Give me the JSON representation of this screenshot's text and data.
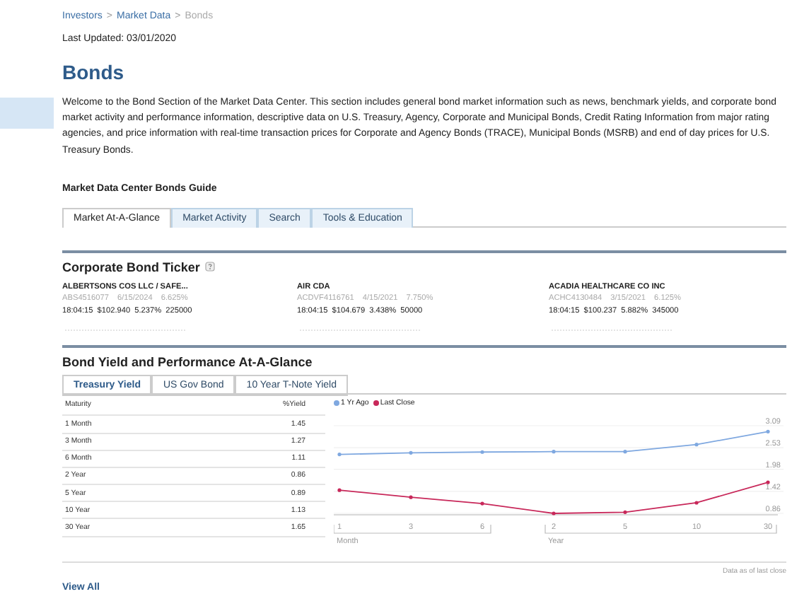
{
  "breadcrumb_separator": ">",
  "breadcrumb": [
    {
      "label": "Investors",
      "current": false
    },
    {
      "label": "Market Data",
      "current": false
    },
    {
      "label": "Bonds",
      "current": true
    }
  ],
  "last_updated": "Last Updated: 03/01/2020",
  "title": "Bonds",
  "intro": "Welcome to the Bond Section of the Market Data Center. This section includes general bond market information such as news, benchmark yields, and corporate bond market activity and performance information, descriptive data on U.S. Treasury, Agency, Corporate and Municipal Bonds, Credit Rating Information from major rating agencies, and price information with real-time transaction prices for Corporate and Agency Bonds (TRACE), Municipal Bonds (MSRB) and end of day prices for U.S. Treasury Bonds.",
  "guide_title": "Market Data Center Bonds Guide",
  "guide_tabs": [
    {
      "label": "Market At-A-Glance",
      "selected": true
    },
    {
      "label": "Market Activity",
      "selected": false
    },
    {
      "label": "Search",
      "selected": false
    },
    {
      "label": "Tools & Education",
      "selected": false
    }
  ],
  "ticker": {
    "title": "Corporate Bond Ticker",
    "items": [
      {
        "name": "ALBERTSONS COS LLC / SAFE...",
        "symbol": "ABS4516077",
        "maturity": "6/15/2024",
        "coupon": "6.625%",
        "time": "18:04:15",
        "price": "$102.940",
        "yield": "5.237%",
        "volume": "225000"
      },
      {
        "name": "AIR CDA",
        "symbol": "ACDVF4116761",
        "maturity": "4/15/2021",
        "coupon": "7.750%",
        "time": "18:04:15",
        "price": "$104.679",
        "yield": "3.438%",
        "volume": "50000"
      },
      {
        "name": "ACADIA HEALTHCARE CO INC",
        "symbol": "ACHC4130484",
        "maturity": "3/15/2021",
        "coupon": "6.125%",
        "time": "18:04:15",
        "price": "$100.237",
        "yield": "5.882%",
        "volume": "345000"
      }
    ]
  },
  "yield_section": {
    "title": "Bond Yield and Performance At-A-Glance",
    "tabs": [
      {
        "label": "Treasury Yield",
        "selected": true
      },
      {
        "label": "US Gov Bond",
        "selected": false
      },
      {
        "label": "10 Year T-Note Yield",
        "selected": false
      }
    ],
    "table": {
      "columns": [
        "Maturity",
        "%Yield"
      ],
      "rows": [
        [
          "1 Month",
          "1.45"
        ],
        [
          "3 Month",
          "1.27"
        ],
        [
          "6 Month",
          "1.11"
        ],
        [
          "2 Year",
          "0.86"
        ],
        [
          "5 Year",
          "0.89"
        ],
        [
          "10 Year",
          "1.13"
        ],
        [
          "30 Year",
          "1.65"
        ]
      ]
    },
    "chart_data": {
      "type": "line",
      "categories": [
        "1",
        "3",
        "6",
        "2",
        "5",
        "10",
        "30"
      ],
      "series": [
        {
          "name": "1 Yr Ago",
          "color": "#7fa8e0",
          "values": [
            2.36,
            2.4,
            2.42,
            2.43,
            2.43,
            2.61,
            2.94
          ]
        },
        {
          "name": "Last Close",
          "color": "#c8285a",
          "values": [
            1.45,
            1.27,
            1.11,
            0.86,
            0.89,
            1.13,
            1.65
          ]
        }
      ],
      "ylim": [
        0.86,
        3.09
      ],
      "yticks": [
        0.86,
        1.42,
        1.98,
        2.53,
        3.09
      ],
      "grid": true
    },
    "axis_groups": [
      "Month",
      "Year"
    ],
    "note": "Data as of last close",
    "view_all": "View All"
  }
}
